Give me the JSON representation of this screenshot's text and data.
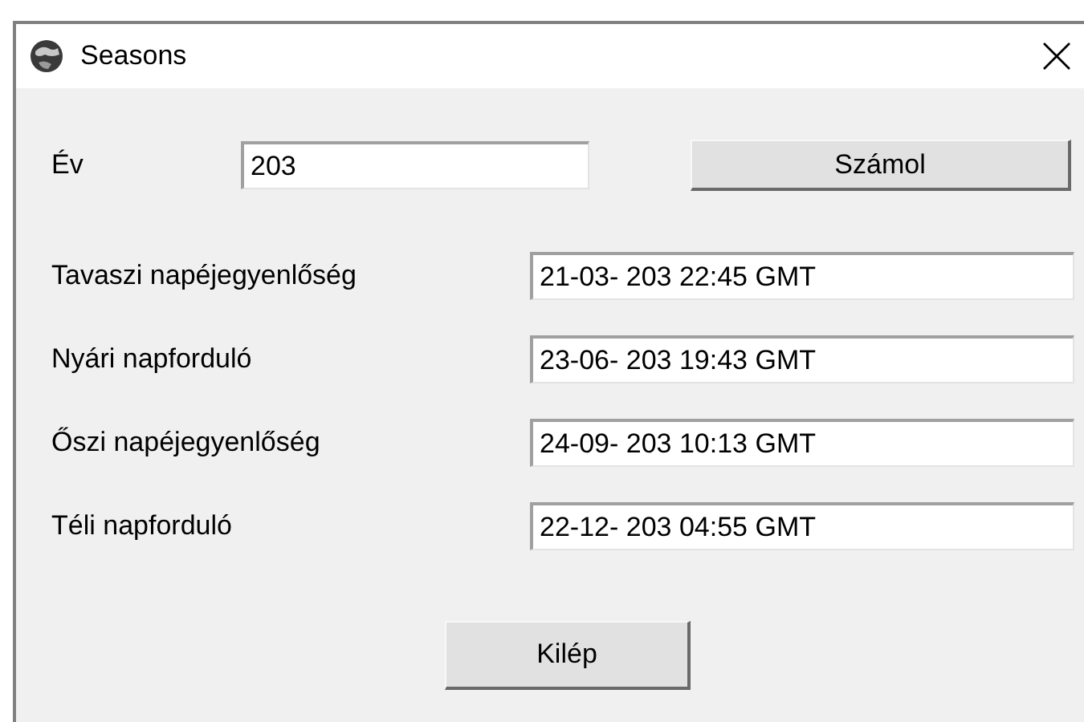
{
  "window": {
    "title": "Seasons"
  },
  "year": {
    "label": "Év",
    "value": "203"
  },
  "calculate_button": "Számol",
  "results": [
    {
      "label": "Tavaszi napéjegyenlőség",
      "value": "21-03- 203 22:45 GMT"
    },
    {
      "label": "Nyári napforduló",
      "value": "23-06- 203 19:43 GMT"
    },
    {
      "label": "Őszi napéjegyenlőség",
      "value": "24-09- 203 10:13 GMT"
    },
    {
      "label": "Téli napforduló",
      "value": "22-12- 203 04:55 GMT"
    }
  ],
  "exit_button": "Kilép"
}
